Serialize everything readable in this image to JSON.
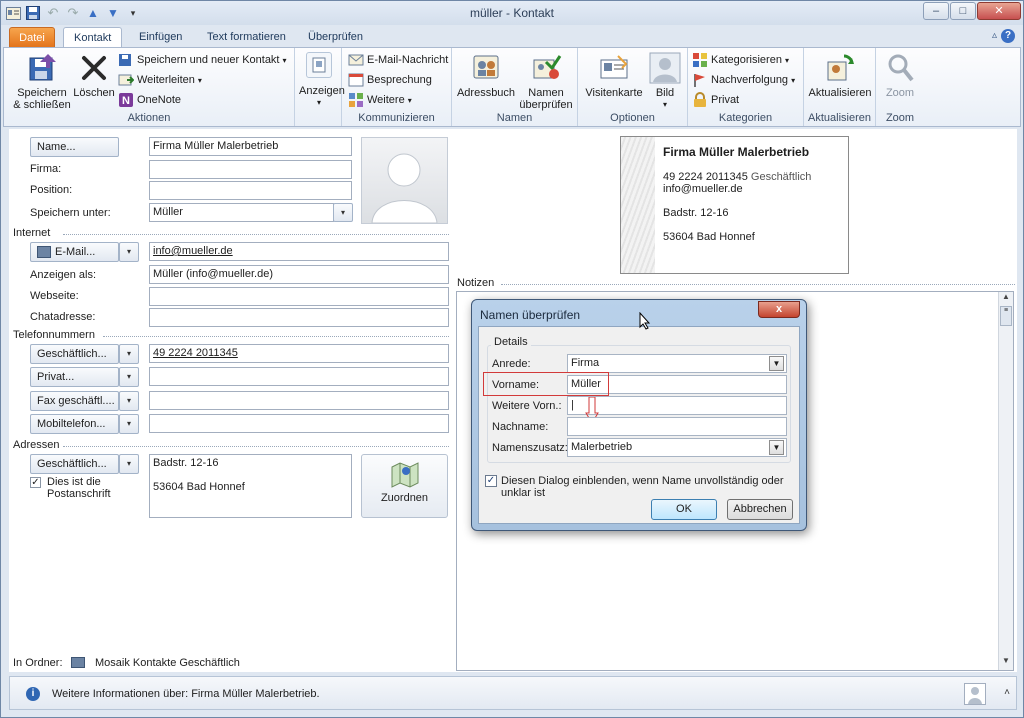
{
  "window": {
    "title": "müller - Kontakt"
  },
  "tabs": [
    {
      "label": "Datei"
    },
    {
      "label": "Kontakt"
    },
    {
      "label": "Einfügen"
    },
    {
      "label": "Text formatieren"
    },
    {
      "label": "Überprüfen"
    }
  ],
  "ribbon": {
    "aktionen": {
      "label": "Aktionen",
      "save_close_1": "Speichern",
      "save_close_2": "& schließen",
      "delete": "Löschen",
      "save_new": "Speichern und neuer Kontakt",
      "forward": "Weiterleiten",
      "onenote": "OneNote"
    },
    "anzeigen": {
      "label": "Anzeigen"
    },
    "kommunizieren": {
      "label": "Kommunizieren",
      "email": "E-Mail-Nachricht",
      "meeting": "Besprechung",
      "more": "Weitere"
    },
    "namen": {
      "label": "Namen",
      "addressbook": "Adressbuch",
      "check_1": "Namen",
      "check_2": "überprüfen"
    },
    "optionen": {
      "label": "Optionen",
      "bizcard": "Visitenkarte",
      "picture": "Bild"
    },
    "kategorien": {
      "label": "Kategorien",
      "categorize": "Kategorisieren",
      "followup": "Nachverfolgung",
      "private": "Privat"
    },
    "aktualisieren": {
      "label": "Aktualisieren",
      "update": "Aktualisieren"
    },
    "zoom": {
      "label": "Zoom",
      "zoom": "Zoom"
    }
  },
  "form": {
    "name_btn": "Name...",
    "name_val": "Firma Müller Malerbetrieb",
    "firma_lbl": "Firma:",
    "position_lbl": "Position:",
    "speichern_lbl": "Speichern unter:",
    "speichern_val": "Müller",
    "internet": "Internet",
    "email_btn": "E-Mail...",
    "email_val": "info@mueller.de",
    "anzeigen_lbl": "Anzeigen als:",
    "anzeigen_val": "Müller (info@mueller.de)",
    "webseite_lbl": "Webseite:",
    "chat_lbl": "Chatadresse:",
    "telefon": "Telefonnummern",
    "phone1_btn": "Geschäftlich...",
    "phone1_val": "49 2224 2011345",
    "phone2_btn": "Privat...",
    "phone3_btn": "Fax geschäftl....",
    "phone4_btn": "Mobiltelefon...",
    "adressen": "Adressen",
    "addr_btn": "Geschäftlich...",
    "addr_line1": "Badstr. 12-16",
    "addr_line2": "53604  Bad Honnef",
    "postal_1": "Dies ist die",
    "postal_2": "Postanschrift",
    "zuordnen": "Zuordnen",
    "notizen": "Notizen",
    "ordner_lbl": "In Ordner:",
    "ordner_val": "Mosaik Kontakte Geschäftlich"
  },
  "card": {
    "name": "Firma Müller Malerbetrieb",
    "phone": "49 2224 2011345",
    "phone_type": "Geschäftlich",
    "email": "info@mueller.de",
    "street": "Badstr. 12-16",
    "city": "53604  Bad Honnef"
  },
  "dialog": {
    "title": "Namen überprüfen",
    "close": "x",
    "details": "Details",
    "anrede_lbl": "Anrede:",
    "anrede_val": "Firma",
    "vorname_lbl": "Vorname:",
    "vorname_val": "Müller",
    "weitere_lbl": "Weitere Vorn.:",
    "weitere_val": "|",
    "nachname_lbl": "Nachname:",
    "nachname_val": "",
    "zusatz_lbl": "Namenszusatz:",
    "zusatz_val": "Malerbetrieb",
    "show_dialog": "Diesen Dialog einblenden, wenn Name unvollständig oder unklar ist",
    "ok": "OK",
    "cancel": "Abbrechen"
  },
  "status": {
    "text": "Weitere Informationen über: Firma Müller Malerbetrieb."
  }
}
